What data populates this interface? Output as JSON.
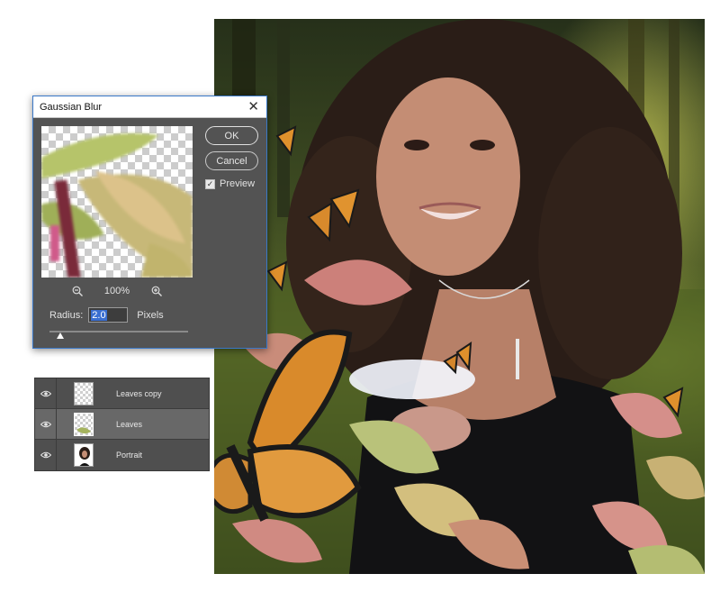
{
  "dialog": {
    "title": "Gaussian Blur",
    "ok_label": "OK",
    "cancel_label": "Cancel",
    "preview_label": "Preview",
    "preview_checked": true,
    "zoom_level": "100%",
    "radius_label": "Radius:",
    "radius_value": "2.0",
    "radius_units": "Pixels",
    "close_glyph": "✕",
    "check_glyph": "✓",
    "icons": {
      "zoom_out": "zoom-out-icon",
      "zoom_in": "zoom-in-icon",
      "close": "close-icon"
    }
  },
  "layers": [
    {
      "name": "Leaves copy",
      "visible": true,
      "selected": false
    },
    {
      "name": "Leaves",
      "visible": true,
      "selected": true
    },
    {
      "name": "Portrait",
      "visible": true,
      "selected": false
    }
  ],
  "colors": {
    "dialog_bg": "#535353",
    "dialog_border": "#3a78c8",
    "selection": "#3b6fd1",
    "panel_bg": "#4f4f4f",
    "active_layer": "#686868",
    "butterfly_orange": "#d98a2b",
    "leaf_pink": "#d88a8a",
    "leaf_green": "#b9c27a"
  }
}
